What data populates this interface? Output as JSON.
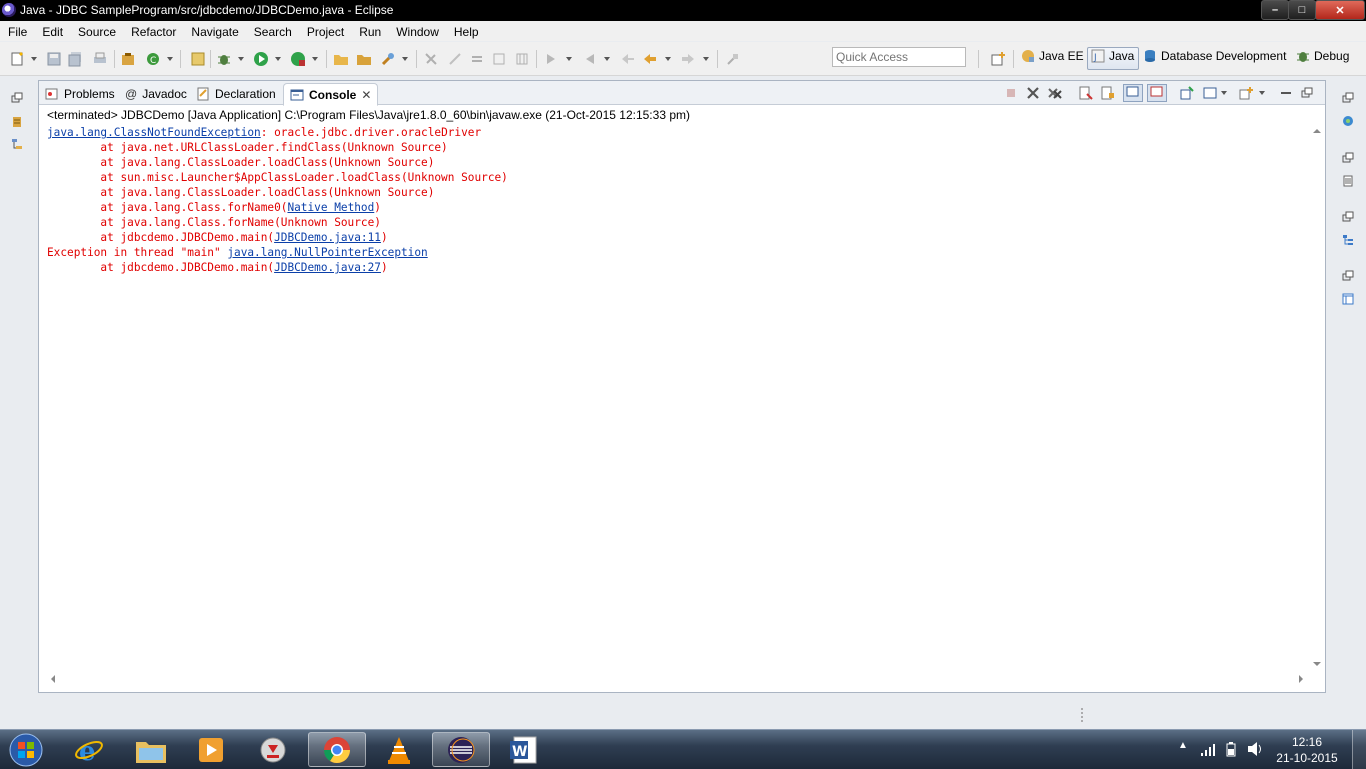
{
  "window": {
    "title": "Java - JDBC SampleProgram/src/jdbcdemo/JDBCDemo.java - Eclipse",
    "controls": {
      "minimize": "–",
      "maximize": "□",
      "close": "✕"
    }
  },
  "menu": [
    "File",
    "Edit",
    "Source",
    "Refactor",
    "Navigate",
    "Search",
    "Project",
    "Run",
    "Window",
    "Help"
  ],
  "toolbar": {
    "quick_access_placeholder": "Quick Access",
    "perspectives": {
      "java_ee": "Java EE",
      "java": "Java",
      "database_development": "Database Development",
      "debug": "Debug"
    }
  },
  "tabs": {
    "problems": "Problems",
    "javadoc": "Javadoc",
    "declaration": "Declaration",
    "console": "Console"
  },
  "console": {
    "status": "<terminated> JDBCDemo [Java Application] C:\\Program Files\\Java\\jre1.8.0_60\\bin\\javaw.exe (21-Oct-2015 12:15:33 pm)",
    "lines": [
      {
        "a": "",
        "link": "java.lang.ClassNotFoundException",
        "b": ": oracle.jdbc.driver.oracleDriver"
      },
      {
        "a": "        at java.net.URLClassLoader.findClass(Unknown Source)"
      },
      {
        "a": "        at java.lang.ClassLoader.loadClass(Unknown Source)"
      },
      {
        "a": "        at sun.misc.Launcher$AppClassLoader.loadClass(Unknown Source)"
      },
      {
        "a": "        at java.lang.ClassLoader.loadClass(Unknown Source)"
      },
      {
        "a": "        at java.lang.Class.forName0(",
        "link": "Native Method",
        "b": ")"
      },
      {
        "a": "        at java.lang.Class.forName(Unknown Source)"
      },
      {
        "a": "        at jdbcdemo.JDBCDemo.main(",
        "link": "JDBCDemo.java:11",
        "b": ")"
      },
      {
        "a": "Exception in thread \"main\" ",
        "link": "java.lang.NullPointerException",
        "b": ""
      },
      {
        "a": "        at jdbcdemo.JDBCDemo.main(",
        "link": "JDBCDemo.java:27",
        "b": ")"
      }
    ]
  },
  "taskbar": {
    "apps": [
      "start-button",
      "internet-explorer",
      "file-explorer",
      "media-player",
      "download-manager",
      "chrome",
      "vlc",
      "eclipse",
      "word"
    ],
    "active_app": "eclipse",
    "clock_time": "12:16",
    "clock_date": "21-10-2015"
  },
  "colors": {
    "console_error": "#e00000",
    "console_link": "#0b3fa8",
    "titlebar": "#000000",
    "taskbar": "#2f3e52"
  }
}
